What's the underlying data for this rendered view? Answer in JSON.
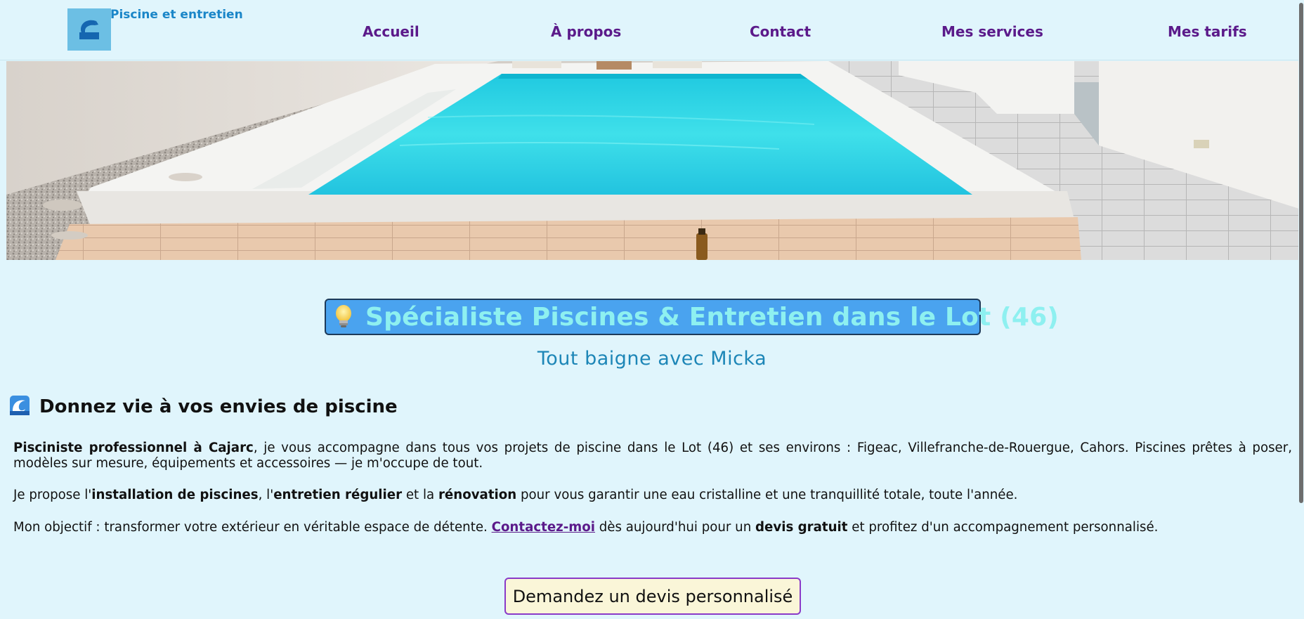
{
  "header": {
    "brand": "Piscine et entretien",
    "logo_icon": "wave-logo-icon",
    "nav": [
      {
        "label": "Accueil"
      },
      {
        "label": "À propos"
      },
      {
        "label": "Contact"
      },
      {
        "label": "Mes services"
      },
      {
        "label": "Mes tarifs"
      }
    ]
  },
  "hero": {
    "image_subject": "swimming pool"
  },
  "main": {
    "title_icon": "lightbulb-icon",
    "title": "Spécialiste Piscines & Entretien dans le Lot (46)",
    "subtitle": "Tout baigne avec Micka",
    "section_icon": "wave-icon",
    "section_title": "Donnez vie à vos envies de piscine",
    "p1": {
      "bold_lead": "Pisciniste professionnel à Cajarc",
      "text": ", je vous accompagne dans tous vos projets de piscine dans le Lot (46) et ses environs : Figeac, Villefranche-de-Rouergue, Cahors. Piscines prêtes à poser, modèles sur mesure, équipements et accessoires — je m'occupe de tout."
    },
    "p2": {
      "t1": "Je propose l'",
      "b1": "installation de piscines",
      "t2": ", l'",
      "b2": "entretien régulier",
      "t3": " et la ",
      "b3": "rénovation",
      "t4": " pour vous garantir une eau cristalline et une tranquillité totale, toute l'année."
    },
    "p3": {
      "t1": "Mon objectif : transformer votre extérieur en véritable espace de détente. ",
      "link": "Contactez-moi",
      "t2": " dès aujourd'hui pour un ",
      "b1": "devis gratuit",
      "t3": " et profitez d'un accompagnement personnalisé."
    },
    "cta": "Demandez un devis personnalisé"
  },
  "colors": {
    "page_bg": "#e0f5fc",
    "nav_link": "#5b1a8a",
    "brand": "#1a86c8",
    "title_bg": "#4aa3ef",
    "title_text": "#8ef0f0",
    "subtitle": "#1d86b7",
    "cta_bg": "#faf6d8",
    "cta_border": "#8a3ac8"
  }
}
